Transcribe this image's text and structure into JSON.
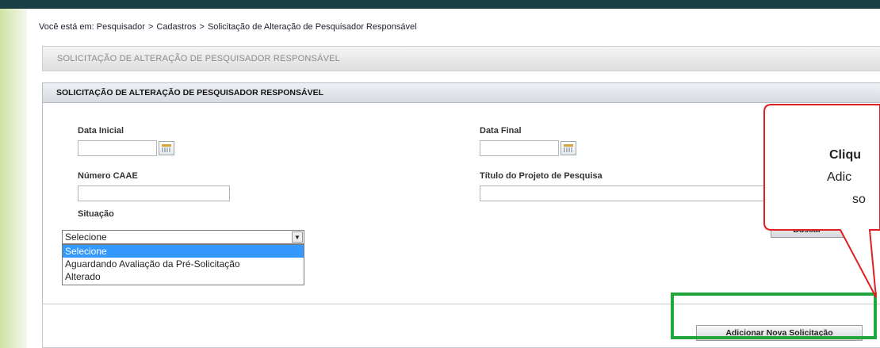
{
  "breadcrumb": {
    "prefix": "Você está em:",
    "items": [
      "Pesquisador",
      "Cadastros",
      "Solicitação de Alteração de Pesquisador Responsável"
    ],
    "separator": ">"
  },
  "page_title": "SOLICITAÇÃO DE ALTERAÇÃO DE PESQUISADOR RESPONSÁVEL",
  "panel": {
    "title": "SOLICITAÇÃO DE ALTERAÇÃO DE PESQUISADOR RESPONSÁVEL",
    "data_inicial_label": "Data Inicial",
    "data_inicial_value": "",
    "data_final_label": "Data Final",
    "data_final_value": "",
    "numero_caae_label": "Número CAAE",
    "numero_caae_value": "",
    "titulo_projeto_label": "Título do Projeto de Pesquisa",
    "titulo_projeto_value": "",
    "situacao_label": "Situação",
    "situacao_selected": "Selecione",
    "situacao_options": [
      "Selecione",
      "Aguardando Avaliação da Pré-Solicitação",
      "Alterado"
    ],
    "buscar_label": "Buscar"
  },
  "actions": {
    "add_label": "Adicionar Nova Solicitação"
  },
  "callout": {
    "line1": "Cliqu",
    "line2": "Adic",
    "line3": "so"
  },
  "colors": {
    "highlight_box": "#22a53a",
    "callout_border": "#e02020",
    "top_bar": "#1c3f47",
    "selected_option": "#3399ff"
  },
  "icons": {
    "calendar": "calendar-icon",
    "dropdown": "chevron-down-icon"
  }
}
